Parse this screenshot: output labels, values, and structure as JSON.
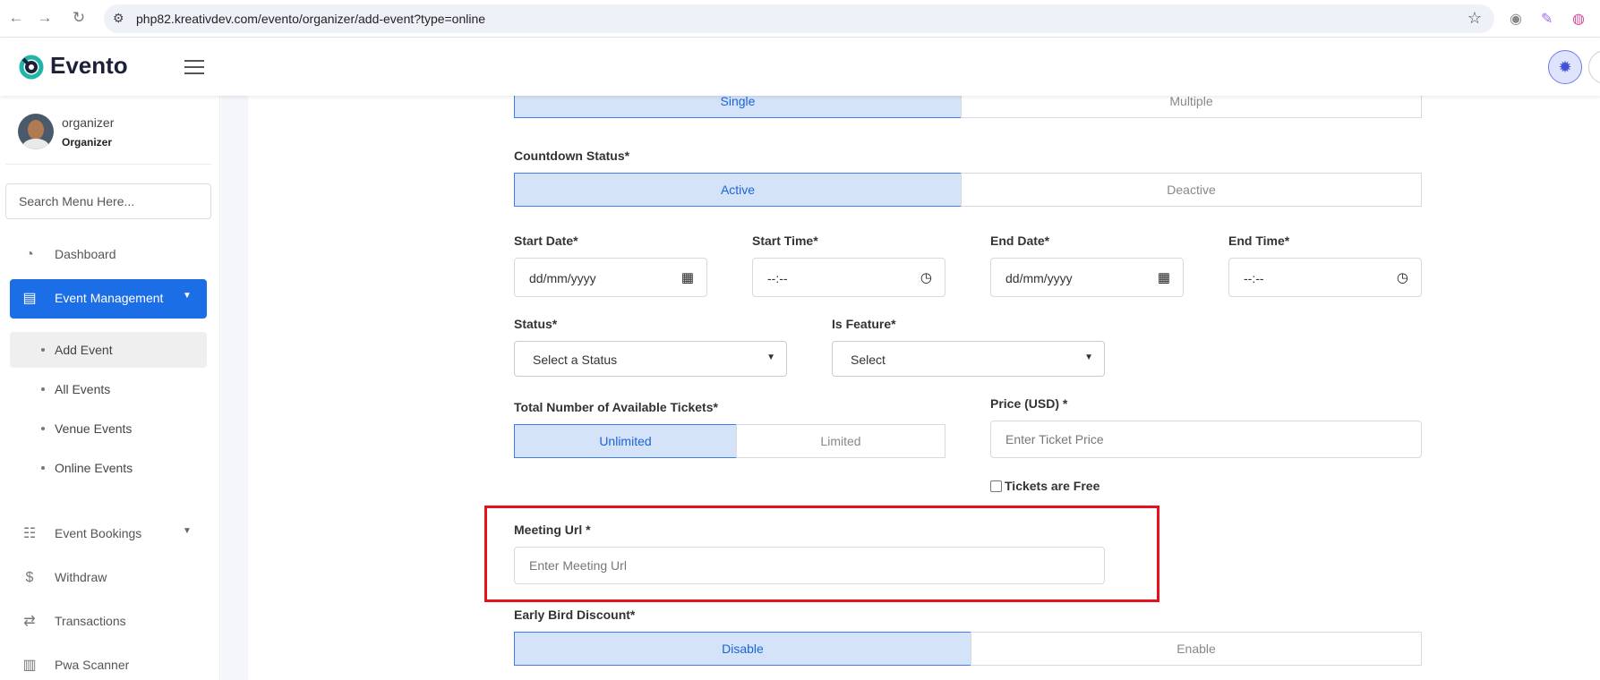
{
  "browser": {
    "url": "php82.kreativdev.com/evento/organizer/add-event?type=online"
  },
  "header": {
    "logo_text": "Evento"
  },
  "sidebar": {
    "profile_name": "organizer",
    "profile_role": "Organizer",
    "search_placeholder": "Search Menu Here...",
    "items": {
      "dashboard": "Dashboard",
      "event_management": "Event Management",
      "event_bookings": "Event Bookings",
      "withdraw": "Withdraw",
      "transactions": "Transactions",
      "pwa_scanner": "Pwa Scanner"
    },
    "submenu": {
      "add_event": "Add Event",
      "all_events": "All Events",
      "venue_events": "Venue Events",
      "online_events": "Online Events"
    },
    "active_item": "Event Management",
    "active_subitem": "Add Event"
  },
  "form": {
    "date_type": {
      "options": [
        "Single",
        "Multiple"
      ],
      "selected": "Single"
    },
    "countdown": {
      "label": "Countdown Status*",
      "options": [
        "Active",
        "Deactive"
      ],
      "selected": "Active"
    },
    "start_date": {
      "label": "Start Date*",
      "value": "dd/mm/yyyy"
    },
    "start_time": {
      "label": "Start Time*",
      "value": "--:--"
    },
    "end_date": {
      "label": "End Date*",
      "value": "dd/mm/yyyy"
    },
    "end_time": {
      "label": "End Time*",
      "value": "--:--"
    },
    "status": {
      "label": "Status*",
      "value": "Select a Status"
    },
    "is_feature": {
      "label": "Is Feature*",
      "value": "Select"
    },
    "tickets": {
      "label": "Total Number of Available Tickets*",
      "options": [
        "Unlimited",
        "Limited"
      ],
      "selected": "Unlimited"
    },
    "price": {
      "label": "Price (USD) *",
      "placeholder": "Enter Ticket Price"
    },
    "free": {
      "label": "Tickets are Free",
      "checked": false
    },
    "meeting_url": {
      "label": "Meeting Url *",
      "placeholder": "Enter Meeting Url"
    },
    "early_bird": {
      "label": "Early Bird Discount*",
      "options": [
        "Disable",
        "Enable"
      ],
      "selected": "Disable"
    }
  },
  "colors": {
    "accent": "#1c6ee6",
    "selected_segment_bg": "#d5e3f9",
    "highlight_border": "#e8101a"
  }
}
